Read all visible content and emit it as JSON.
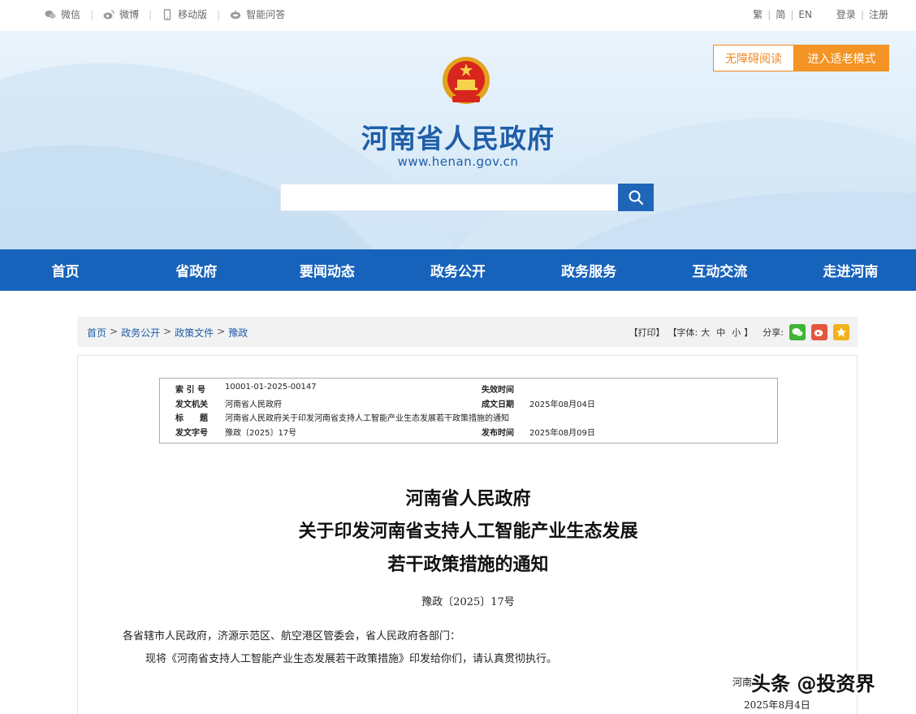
{
  "topbar": {
    "links": [
      "微信",
      "微博",
      "移动版",
      "智能问答"
    ],
    "lang": [
      "繁",
      "简",
      "EN"
    ],
    "login": "登录",
    "register": "注册"
  },
  "header": {
    "title": "河南省人民政府",
    "url": "www.henan.gov.cn",
    "accessibility_btn": "无障碍阅读",
    "elder_btn": "进入适老模式",
    "search_placeholder": ""
  },
  "nav": [
    "首页",
    "省政府",
    "要闻动态",
    "政务公开",
    "政务服务",
    "互动交流",
    "走进河南"
  ],
  "breadcrumb": [
    "首页",
    "政务公开",
    "政策文件",
    "豫政"
  ],
  "tools": {
    "print": "【打印】",
    "font_label": "【字体:",
    "sizes": [
      "大",
      "中",
      "小"
    ],
    "font_close": "】",
    "share": "分享:"
  },
  "meta": {
    "index_label": "索 引 号",
    "index_value": "10001-01-2025-00147",
    "expire_label": "失效时间",
    "expire_value": "",
    "issuer_label": "发文机关",
    "issuer_value": "河南省人民政府",
    "created_label": "成文日期",
    "created_value": "2025年08月04日",
    "title_label": "标　　题",
    "title_value": "河南省人民政府关于印发河南省支持人工智能产业生态发展若干政策措施的通知",
    "docno_label": "发文字号",
    "docno_value": "豫政〔2025〕17号",
    "publish_label": "发布时间",
    "publish_value": "2025年08月09日"
  },
  "doc": {
    "title_line1": "河南省人民政府",
    "title_line2": "关于印发河南省支持人工智能产业生态发展",
    "title_line3": "若干政策措施的通知",
    "doc_no": "豫政〔2025〕17号",
    "salutation": "各省辖市人民政府，济源示范区、航空港区管委会，省人民政府各部门：",
    "body": "现将《河南省支持人工智能产业生态发展若干政策措施》印发给你们，请认真贯彻执行。",
    "signature_partial": "河南",
    "date": "2025年8月4日"
  },
  "watermark": "头条 @投资界",
  "colors": {
    "nav_blue": "#1763bb",
    "title_blue": "#1f5ea8",
    "orange": "#f39424"
  }
}
